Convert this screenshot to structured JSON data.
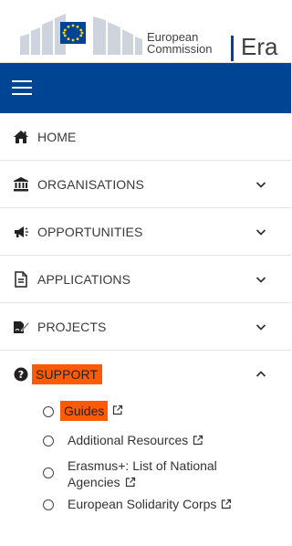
{
  "header": {
    "commission_line1": "European",
    "commission_line2": "Commission",
    "app_title": "Era"
  },
  "colors": {
    "brand_blue": "#004494",
    "highlight": "#ff5a00",
    "eu_star": "#ffd617"
  },
  "menu": {
    "items": [
      {
        "label": "HOME",
        "icon": "home-icon"
      },
      {
        "label": "ORGANISATIONS",
        "icon": "institution-icon"
      },
      {
        "label": "OPPORTUNITIES",
        "icon": "megaphone-icon"
      },
      {
        "label": "APPLICATIONS",
        "icon": "document-icon"
      },
      {
        "label": "PROJECTS",
        "icon": "signature-icon"
      },
      {
        "label": "SUPPORT",
        "icon": "question-circle-icon"
      }
    ],
    "support_submenu": [
      {
        "label": "Guides"
      },
      {
        "label": "Additional Resources"
      },
      {
        "label_line1": "Erasmus+: List of National",
        "label_line2": "Agencies"
      },
      {
        "label": "European Solidarity Corps"
      }
    ]
  }
}
